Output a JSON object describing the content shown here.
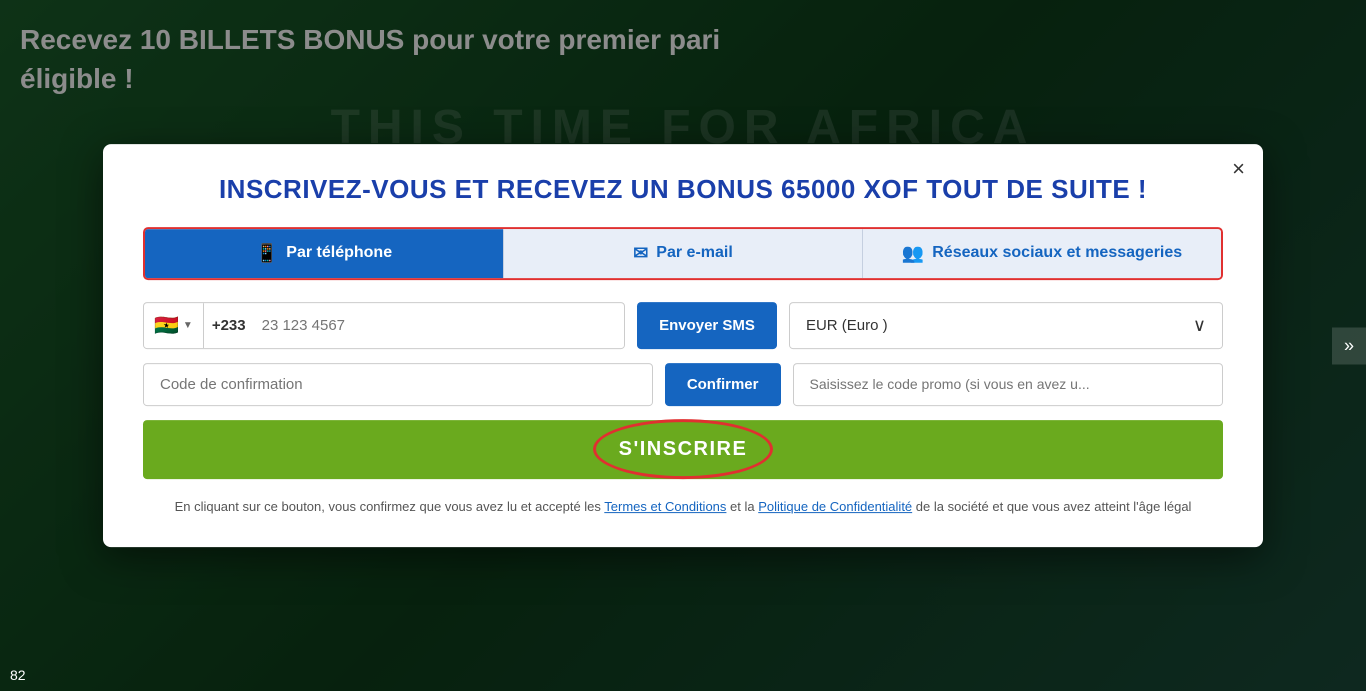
{
  "background": {
    "promo_text_line1": "Recevez 10 BILLETS BONUS pour votre premier pari",
    "promo_text_line2": "éligible !",
    "africa_text": "THIS TIME FOR AFRICA"
  },
  "modal": {
    "close_label": "×",
    "title": "INSCRIVEZ-VOUS ET RECEVEZ UN BONUS 65000 XOF TOUT DE SUITE !",
    "tabs": [
      {
        "id": "phone",
        "label": "Par téléphone",
        "icon": "📱",
        "active": true
      },
      {
        "id": "email",
        "label": "Par e-mail",
        "icon": "✉",
        "active": false
      },
      {
        "id": "social",
        "label": "Réseaux sociaux et messageries",
        "icon": "👥",
        "active": false
      }
    ],
    "phone_section": {
      "flag_emoji": "🇬🇭",
      "phone_prefix": "+233",
      "phone_placeholder": "23 123 4567",
      "send_sms_label": "Envoyer SMS",
      "currency_value": "EUR (Euro )",
      "confirmation_placeholder": "Code de confirmation",
      "confirm_label": "Confirmer",
      "promo_placeholder": "Saisissez le code promo (si vous en avez u..."
    },
    "register_button_label": "S'INSCRIRE",
    "legal": {
      "text_before": "En cliquant sur ce bouton, vous confirmez que vous avez lu et accepté les ",
      "terms_label": "Termes et Conditions",
      "text_middle": " et la ",
      "privacy_label": "Politique de Confidentialité",
      "text_after": " de la société et que vous avez atteint l'âge légal"
    }
  },
  "bottom": {
    "page_number": "82"
  },
  "side_nav": {
    "arrow_label": "»"
  }
}
